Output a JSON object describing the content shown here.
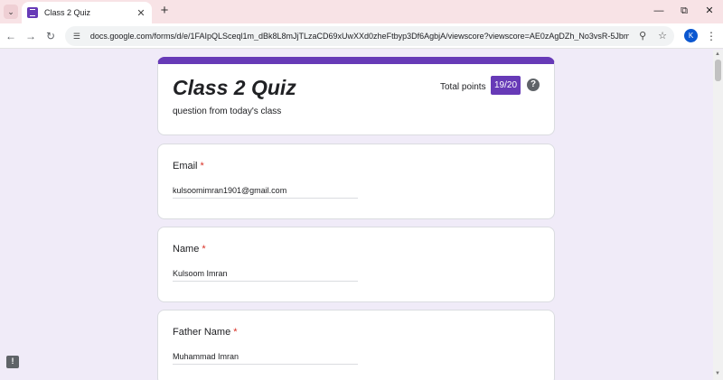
{
  "browser": {
    "tab_title": "Class 2 Quiz",
    "url": "docs.google.com/forms/d/e/1FAIpQLSceql1m_dBk8L8mJjTLzaCD69xUwXXd0zheFtbyp3Df6AgbjA/viewscore?viewscore=AE0zAgDZh_No3vsR-5JbmHdCNO...",
    "profile_initial": "K",
    "icons": {
      "tab_search": "chevron-down-icon",
      "favicon": "forms-icon",
      "tab_close": "close-icon",
      "new_tab": "plus-icon",
      "minimize": "minimize-icon",
      "restore": "restore-icon",
      "close_window": "close-icon",
      "back": "back-arrow-icon",
      "forward": "forward-arrow-icon",
      "reload": "reload-icon",
      "site_info": "tune-icon",
      "zoom": "zoom-icon",
      "bookmark": "star-icon",
      "menu": "kebab-menu-icon"
    }
  },
  "form": {
    "accent_color": "#673ab7",
    "title": "Class 2 Quiz",
    "description": "question from today's class",
    "total_points_label": "Total points",
    "score": "19/20",
    "questions": [
      {
        "label": "Email",
        "required_mark": "*",
        "answer": "kulsoomimran1901@gmail.com"
      },
      {
        "label": "Name",
        "required_mark": "*",
        "answer": "Kulsoom Imran"
      },
      {
        "label": "Father Name",
        "required_mark": "*",
        "answer": "Muhammad Imran"
      }
    ]
  }
}
